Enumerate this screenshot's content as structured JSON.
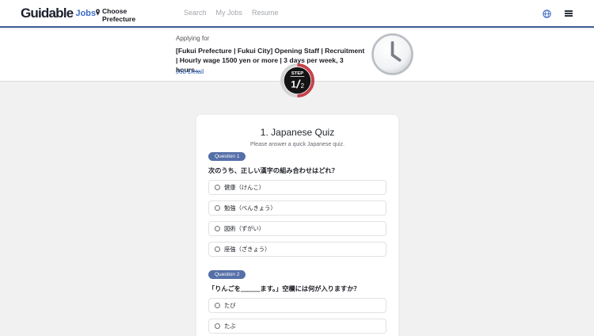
{
  "header": {
    "logo_main": "Guidable",
    "logo_sub": "Jobs",
    "prefecture_label": "Choose Prefecture",
    "nav": [
      "Search",
      "My Jobs",
      "Resume"
    ],
    "globe_icon": "globe-icon",
    "menu_icon": "hamburger-menu-icon"
  },
  "banner": {
    "applying_label": "Applying for",
    "job_title": "[Fukui Prefecture | Fukui City] Opening Staff | Recruitment | Hourly wage 1500 yen or more | 3 days per week, 3 hours...",
    "job_detail_link": "Job Detail",
    "step_label": "STEP",
    "step_current": "1",
    "step_total": "2",
    "step_progress_fraction": 0.5
  },
  "quiz": {
    "title": "1. Japanese Quiz",
    "subtitle": "Please answer a quick Japanese quiz.",
    "questions": [
      {
        "badge": "Question 1",
        "text": "次のうち、正しい漢字の組み合わせはどれ？",
        "options": [
          "健康（けんこ）",
          "勉強（べんきょう）",
          "図術（ずがい）",
          "座強（ざきょう）"
        ]
      },
      {
        "badge": "Question 2",
        "text": "「りんごを＿＿＿ます。」空欄には何が入りますか？",
        "options": [
          "たび",
          "たぶ"
        ]
      }
    ]
  },
  "colors": {
    "accent": "#3c6bc4",
    "badge": "#556fa8",
    "step_red": "#c7414c"
  }
}
